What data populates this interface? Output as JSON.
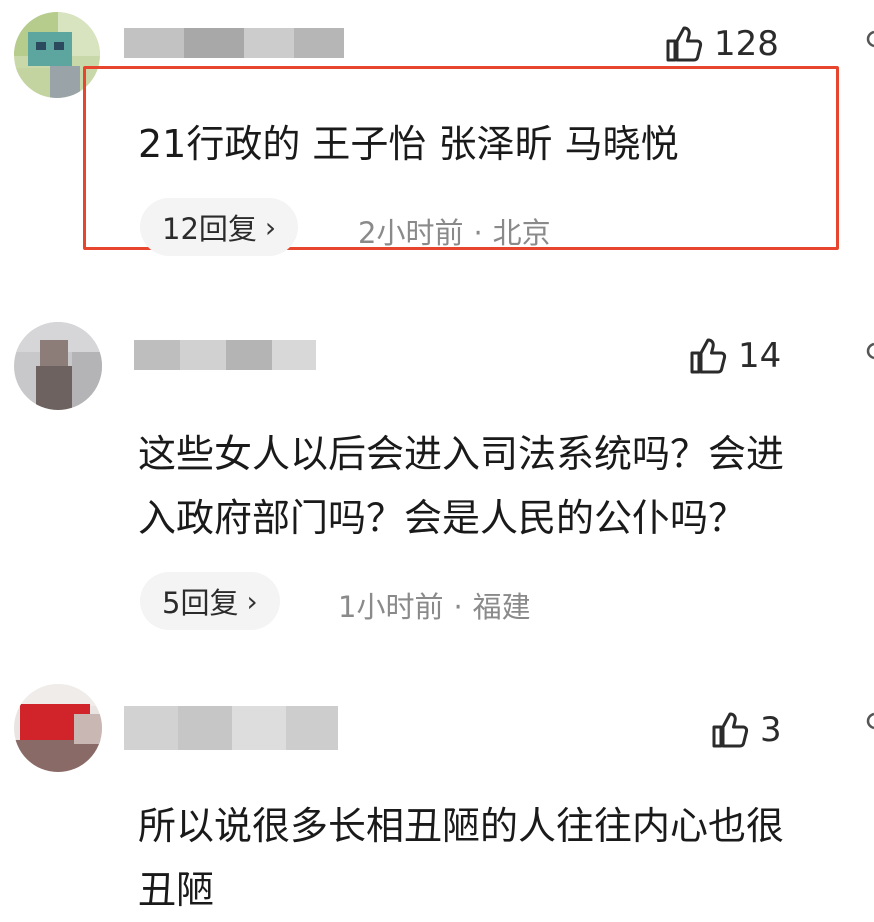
{
  "colors": {
    "highlight_border": "#e8452e",
    "meta_text": "#8a8a8a",
    "reply_pill_bg": "#f4f4f4"
  },
  "comments": [
    {
      "username": "",
      "like_icon": "thumbs-up-icon",
      "like_count": "128",
      "text_lines": [
        "21行政的 王子怡 张泽昕 马晓悦"
      ],
      "reply_label": "12回复",
      "reply_chevron": "›",
      "time": "2小时前",
      "separator": "·",
      "location": "北京",
      "highlighted": true
    },
    {
      "username": "",
      "like_icon": "thumbs-up-icon",
      "like_count": "14",
      "text_lines": [
        "这些女人以后会进入司法系统吗？会进",
        "入政府部门吗？会是人民的公仆吗？"
      ],
      "reply_label": "5回复",
      "reply_chevron": "›",
      "time": "1小时前",
      "separator": "·",
      "location": "福建",
      "highlighted": false
    },
    {
      "username": "",
      "like_icon": "thumbs-up-icon",
      "like_count": "3",
      "text_lines": [
        "所以说很多长相丑陋的人往往内心也很",
        "丑陋"
      ],
      "highlighted": false
    }
  ]
}
